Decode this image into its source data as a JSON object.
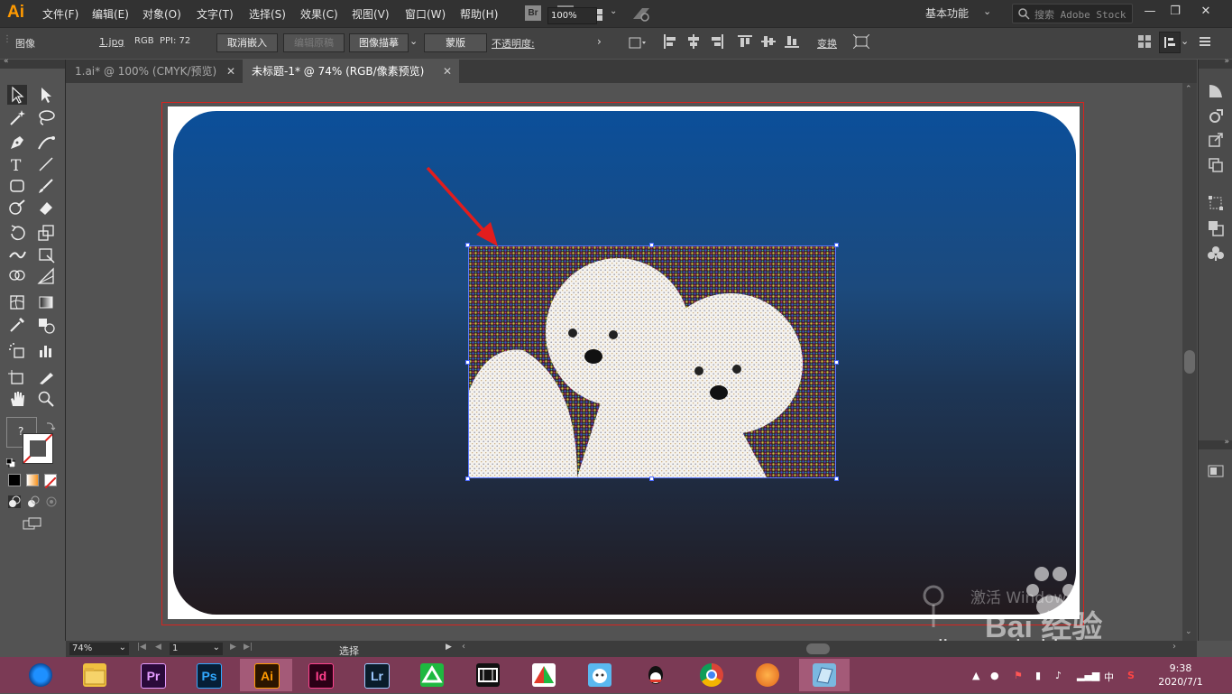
{
  "app": {
    "logo": "Ai"
  },
  "menu": [
    {
      "id": "file",
      "label": "文件(F)"
    },
    {
      "id": "edit",
      "label": "编辑(E)"
    },
    {
      "id": "object",
      "label": "对象(O)"
    },
    {
      "id": "type",
      "label": "文字(T)"
    },
    {
      "id": "select",
      "label": "选择(S)"
    },
    {
      "id": "effect",
      "label": "效果(C)"
    },
    {
      "id": "view",
      "label": "视图(V)"
    },
    {
      "id": "window",
      "label": "窗口(W)"
    },
    {
      "id": "help",
      "label": "帮助(H)"
    }
  ],
  "menubar_icons": {
    "bridge": "Br",
    "stock": "St"
  },
  "workspace": {
    "label": "基本功能"
  },
  "search": {
    "placeholder": "搜索 Adobe Stock"
  },
  "control": {
    "object_type": "图像",
    "file_name": "1.jpg",
    "color_mode": "RGB",
    "ppi": "PPI: 72",
    "unembed": "取消嵌入",
    "edit_original": "编辑原稿",
    "image_trace": "图像描摹",
    "mask": "蒙版",
    "opacity_label": "不透明度:",
    "opacity_value": "100%",
    "transform": "变换"
  },
  "tabs": [
    {
      "label": "1.ai* @ 100% (CMYK/预览)",
      "active": false
    },
    {
      "label": "未标题-1* @ 74% (RGB/像素预览)",
      "active": true
    }
  ],
  "status": {
    "zoom": "74%",
    "page": "1",
    "tool": "选择"
  },
  "tools": {
    "question": "?"
  },
  "colors": {
    "menubar": "#323232",
    "panel": "#535353",
    "accent_ai": "#ff9a00",
    "selection": "#4a68ff",
    "artboard_border": "#d7231f",
    "taskbar": "#7b3a55"
  },
  "taskbar": {
    "apps": [
      {
        "name": "browser",
        "label": ""
      },
      {
        "name": "explorer",
        "label": ""
      },
      {
        "name": "premiere",
        "label": "Pr"
      },
      {
        "name": "photoshop",
        "label": "Ps"
      },
      {
        "name": "illustrator",
        "label": "Ai"
      },
      {
        "name": "indesign",
        "label": "Id"
      },
      {
        "name": "lightroom",
        "label": "Lr"
      },
      {
        "name": "app-green",
        "label": ""
      },
      {
        "name": "video-editor",
        "label": ""
      },
      {
        "name": "app-triangle",
        "label": ""
      },
      {
        "name": "app-cat",
        "label": ""
      },
      {
        "name": "qq",
        "label": ""
      },
      {
        "name": "chrome",
        "label": ""
      },
      {
        "name": "app-orange",
        "label": ""
      },
      {
        "name": "app-book",
        "label": ""
      }
    ],
    "ime": "中",
    "time": "9:38",
    "date": "2020/7/1"
  },
  "watermark": {
    "activate": "激活 Windows",
    "brand": "Bai 经验",
    "url": "jingyan.baidu.com"
  }
}
